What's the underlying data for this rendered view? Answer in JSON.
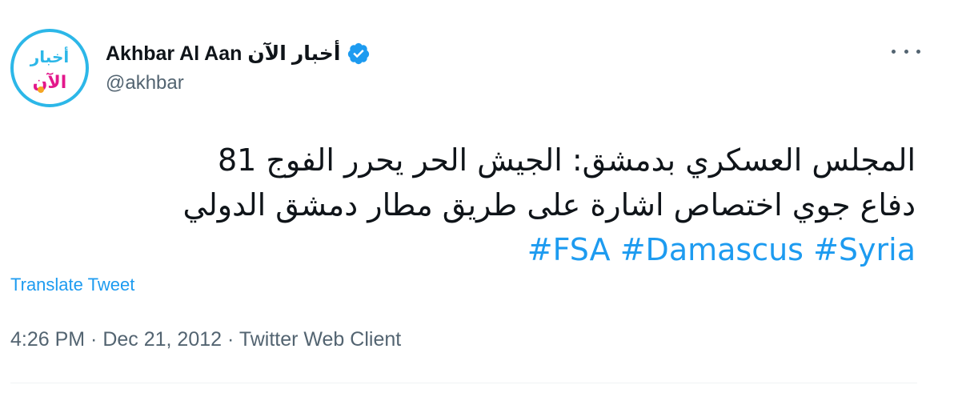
{
  "account": {
    "display_name": "Akhbar Al Aan أخبار الآن",
    "handle": "@akhbar",
    "verified": true,
    "avatar_text_top": "أخبار",
    "avatar_text_bottom": "الآن"
  },
  "tweet": {
    "line_1": "المجلس العسكري بدمشق: الجيش الحر يحرر الفوج 81",
    "line_2": "دفاع جوي اختصاص اشارة على طريق مطار دمشق الدولي",
    "hashtags": [
      "#FSA",
      "#Damascus",
      "#Syria"
    ]
  },
  "translate_label": "Translate Tweet",
  "meta": {
    "time": "4:26 PM",
    "separator": " · ",
    "date": "Dec 21, 2012",
    "source": "Twitter Web Client"
  },
  "colors": {
    "link": "#1d9bf0",
    "secondary_text": "#536471",
    "primary_text": "#0f1419"
  },
  "icons": {
    "verified": "verified-badge-icon",
    "more": "more-options-icon"
  }
}
